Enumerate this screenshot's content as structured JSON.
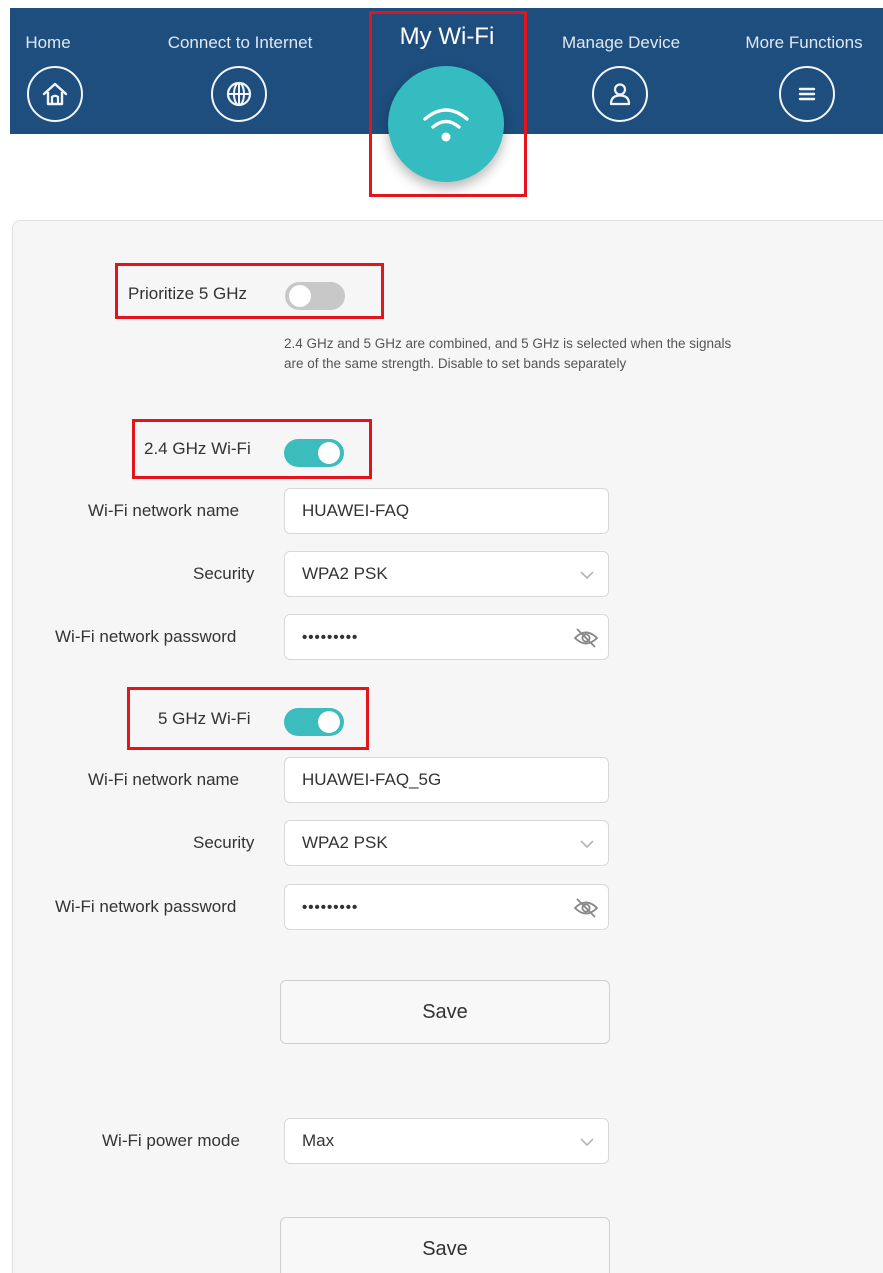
{
  "nav": {
    "home": "Home",
    "connect": "Connect to Internet",
    "my_wifi": "My Wi-Fi",
    "manage": "Manage Device",
    "more": "More Functions"
  },
  "prioritize": {
    "label": "Prioritize 5 GHz",
    "enabled": false,
    "hint": "2.4 GHz and 5 GHz are combined, and 5 GHz is selected when the signals are of the same strength. Disable to set bands separately"
  },
  "band24": {
    "label": "2.4 GHz Wi-Fi",
    "enabled": true,
    "name_label": "Wi-Fi network name",
    "name_value": "HUAWEI-FAQ",
    "security_label": "Security",
    "security_value": "WPA2 PSK",
    "password_label": "Wi-Fi network password",
    "password_value": "•••••••••"
  },
  "band5": {
    "label": "5 GHz Wi-Fi",
    "enabled": true,
    "name_label": "Wi-Fi network name",
    "name_value": "HUAWEI-FAQ_5G",
    "security_label": "Security",
    "security_value": "WPA2 PSK",
    "password_label": "Wi-Fi network password",
    "password_value": "•••••••••"
  },
  "save_label": "Save",
  "power": {
    "label": "Wi-Fi power mode",
    "value": "Max"
  },
  "save2_label": "Save",
  "colors": {
    "nav_bg": "#1e4e7e",
    "accent": "#34bcc0",
    "highlight": "#e3141c"
  },
  "icons": [
    "home-icon",
    "globe-icon",
    "wifi-icon",
    "user-icon",
    "menu-icon",
    "chevron-down-icon",
    "eye-hidden-icon"
  ]
}
